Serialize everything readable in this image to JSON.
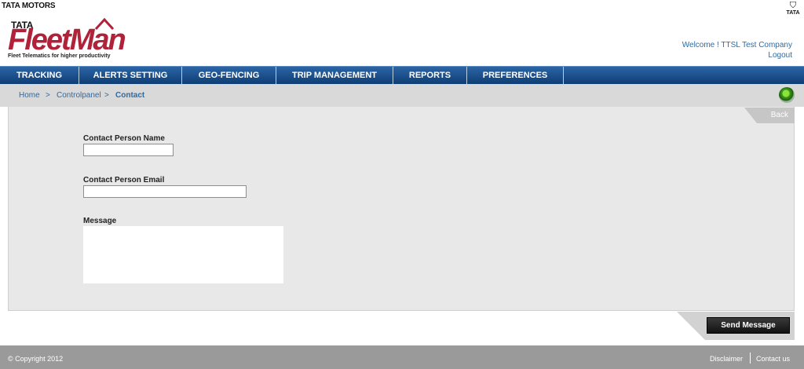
{
  "header": {
    "brand_top": "TATA MOTORS",
    "brand_right": "TATA",
    "logo_tata": "TATA",
    "logo_fleetman": "FleetMan",
    "tagline": "Fleet Telematics for higher productivity",
    "welcome": "Welcome ! TTSL Test Company",
    "logout": "Logout"
  },
  "nav": {
    "items": [
      {
        "label": "TRACKING"
      },
      {
        "label": "ALERTS SETTING"
      },
      {
        "label": "GEO-FENCING"
      },
      {
        "label": "TRIP MANAGEMENT"
      },
      {
        "label": "REPORTS"
      },
      {
        "label": "PREFERENCES"
      }
    ]
  },
  "breadcrumb": {
    "home": "Home",
    "sep": ">",
    "controlpanel": "Controlpanel",
    "current": "Contact"
  },
  "form": {
    "back": "Back",
    "name_label": "Contact Person Name",
    "name_value": "",
    "email_label": "Contact Person Email",
    "email_value": "",
    "message_label": "Message",
    "message_value": "",
    "send": "Send Message"
  },
  "footer": {
    "copyright": "© Copyright 2012",
    "disclaimer": "Disclaimer",
    "contact": "Contact us"
  },
  "colors": {
    "nav": "#1e5592",
    "link": "#2c6aa5",
    "brand": "#b0223a",
    "status": "#3c9a1a"
  }
}
